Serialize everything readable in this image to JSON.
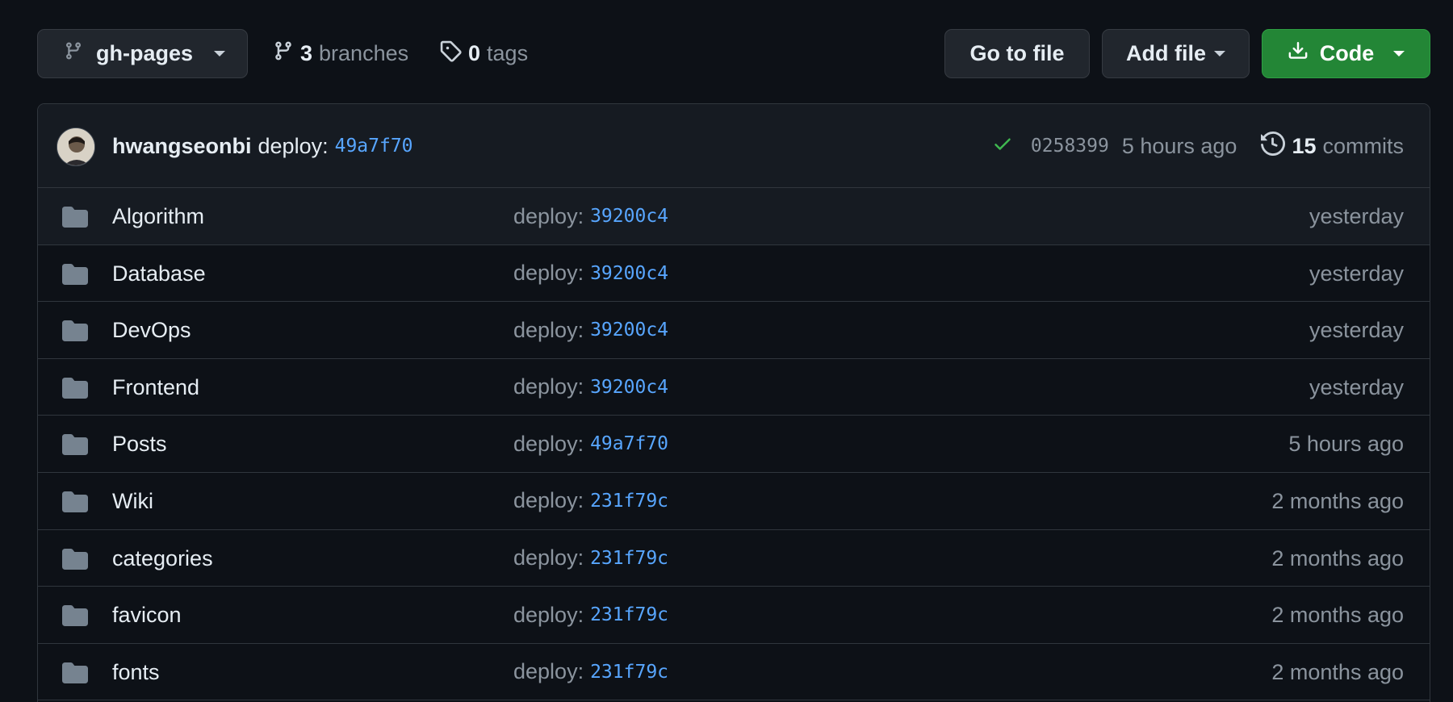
{
  "toolbar": {
    "branch_name": "gh-pages",
    "branches_count": "3",
    "branches_label": "branches",
    "tags_count": "0",
    "tags_label": "tags",
    "go_to_file_label": "Go to file",
    "add_file_label": "Add file",
    "code_label": "Code"
  },
  "latest_commit": {
    "author": "hwangseonbi",
    "message": "deploy:",
    "message_sha": "49a7f70",
    "status": "success",
    "sha": "0258399",
    "time": "5 hours ago",
    "commits_count": "15",
    "commits_label": "commits"
  },
  "files": [
    {
      "name": "Algorithm",
      "message": "deploy:",
      "sha": "39200c4",
      "time": "yesterday"
    },
    {
      "name": "Database",
      "message": "deploy:",
      "sha": "39200c4",
      "time": "yesterday"
    },
    {
      "name": "DevOps",
      "message": "deploy:",
      "sha": "39200c4",
      "time": "yesterday"
    },
    {
      "name": "Frontend",
      "message": "deploy:",
      "sha": "39200c4",
      "time": "yesterday"
    },
    {
      "name": "Posts",
      "message": "deploy:",
      "sha": "49a7f70",
      "time": "5 hours ago"
    },
    {
      "name": "Wiki",
      "message": "deploy:",
      "sha": "231f79c",
      "time": "2 months ago"
    },
    {
      "name": "categories",
      "message": "deploy:",
      "sha": "231f79c",
      "time": "2 months ago"
    },
    {
      "name": "favicon",
      "message": "deploy:",
      "sha": "231f79c",
      "time": "2 months ago"
    },
    {
      "name": "fonts",
      "message": "deploy:",
      "sha": "231f79c",
      "time": "2 months ago"
    }
  ],
  "icons": {
    "branch": "git-branch-icon",
    "tag": "tag-icon",
    "download": "download-icon",
    "check": "check-icon",
    "history": "history-icon",
    "folder": "folder-icon"
  },
  "colors": {
    "background": "#0d1117",
    "surface": "#161b22",
    "border": "#30363d",
    "link": "#58a6ff",
    "muted": "#8b949e",
    "success": "#3fb950",
    "primary_button": "#238636"
  }
}
